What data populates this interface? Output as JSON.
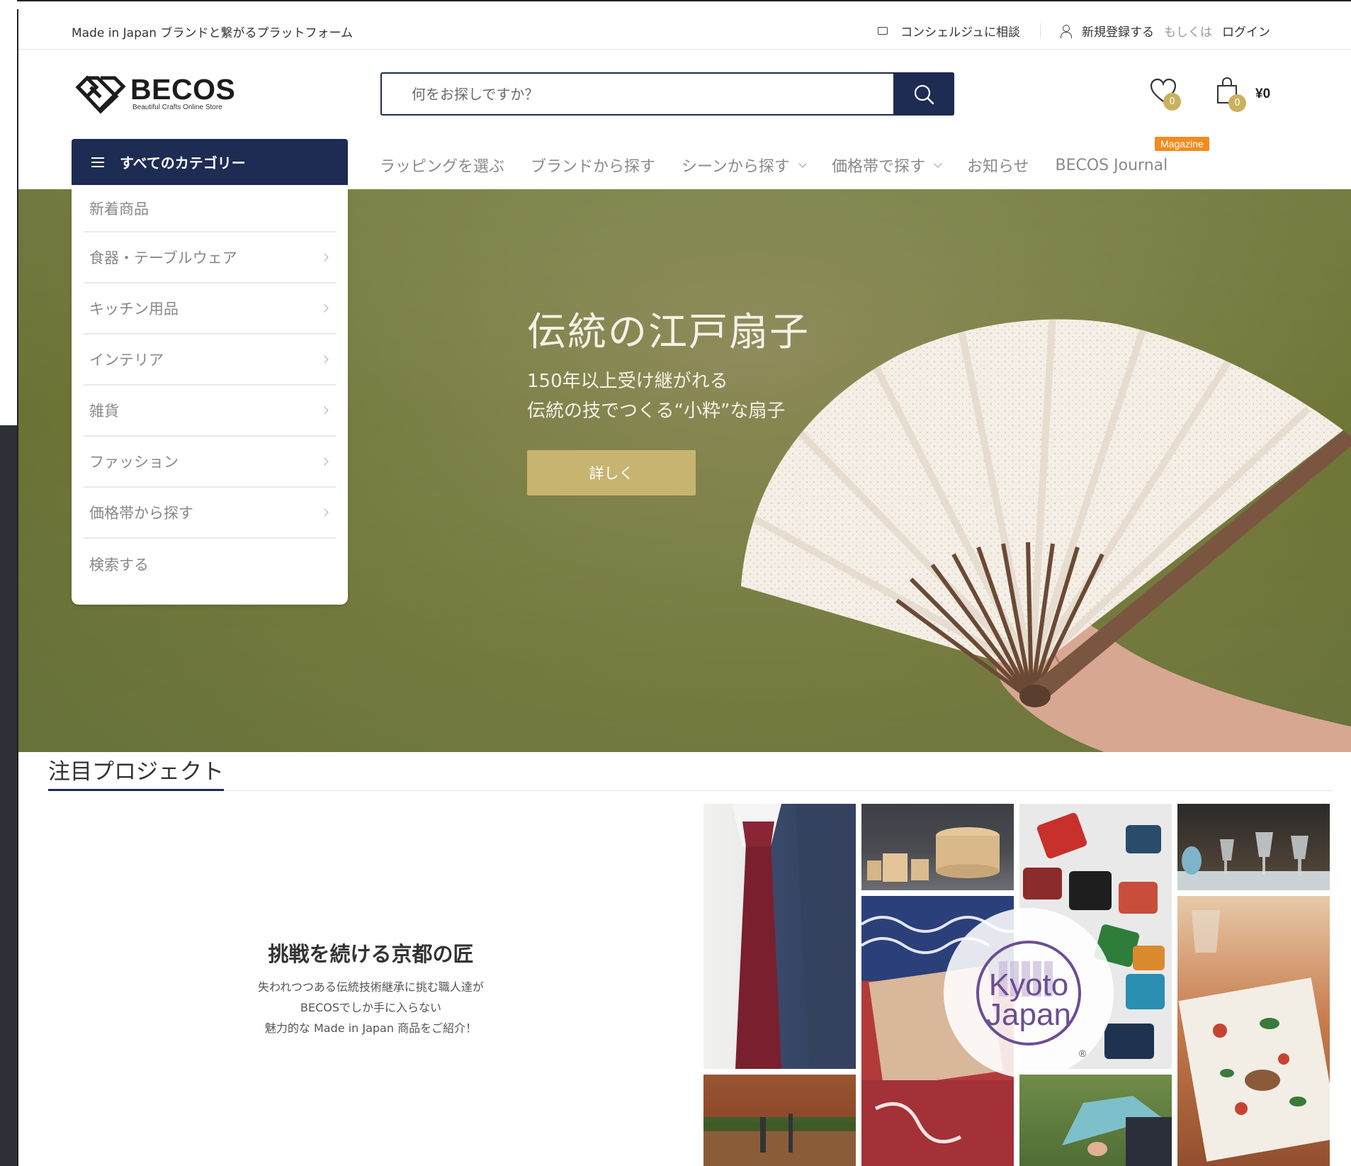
{
  "topbar": {
    "tagline": "Made in Japan ブランドと繋がるプラットフォーム",
    "concierge": "コンシェルジュに相談",
    "register": "新規登録する",
    "or": "もしくは",
    "login": "ログイン"
  },
  "logo": {
    "name": "BECOS",
    "sub": "Beautiful Crafts Online Store"
  },
  "search": {
    "placeholder": "何をお探しですか？"
  },
  "header": {
    "wishlist_count": "0",
    "cart_count": "0",
    "cart_total": "¥0"
  },
  "nav": {
    "all_categories": "すべてのカテゴリー",
    "items": [
      {
        "label": "ラッピングを選ぶ"
      },
      {
        "label": "ブランドから探す"
      },
      {
        "label": "シーンから探す"
      },
      {
        "label": "価格帯で探す"
      },
      {
        "label": "お知らせ"
      },
      {
        "label": "BECOS Journal"
      }
    ],
    "magazine_badge": "Magazine"
  },
  "category_menu": [
    {
      "label": "新着商品"
    },
    {
      "label": "食器・テーブルウェア"
    },
    {
      "label": "キッチン用品"
    },
    {
      "label": "インテリア"
    },
    {
      "label": "雑貨"
    },
    {
      "label": "ファッション"
    },
    {
      "label": "価格帯から探す"
    },
    {
      "label": "検索する"
    }
  ],
  "hero": {
    "title": "伝統の江戸扇子",
    "subtitle_line1": "150年以上受け継がれる",
    "subtitle_line2": "伝統の技でつくる“小粋”な扇子",
    "button": "詳しく"
  },
  "featured": {
    "section_title": "注目プロジェクト",
    "project_title": "挑戦を続ける京都の匠",
    "desc_line1": "失われつつある伝統技術継承に挑む職人達が",
    "desc_line2": "BECOSでしか手に入らない",
    "desc_line3": "魅力的な Made in Japan 商品をご紹介！",
    "kyoto_logo_line1": "Kyoto",
    "kyoto_logo_line2": "Japan"
  },
  "colors": {
    "navy": "#1e2b52",
    "gold_badge": "#c9b15d",
    "hero_button": "#c6b470",
    "magazine_orange": "#f28c1e"
  }
}
